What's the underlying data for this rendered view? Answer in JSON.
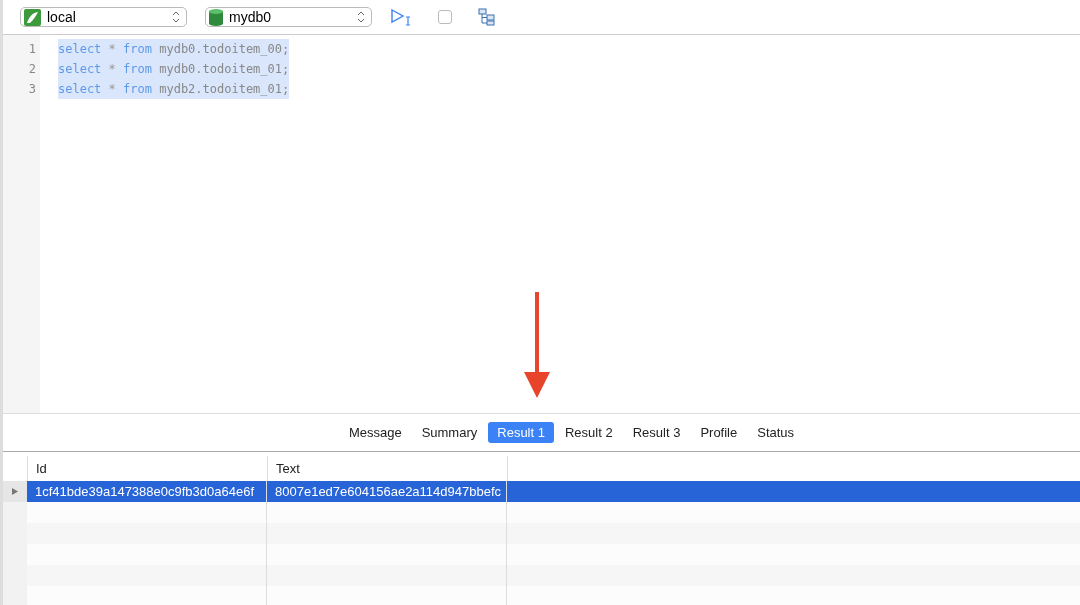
{
  "toolbar": {
    "connection": "local",
    "database": "mydb0",
    "stop_checked": false
  },
  "editor": {
    "lines": [
      {
        "number": "1",
        "selected": true,
        "tokens": [
          {
            "kind": "keyword",
            "text": "select"
          },
          {
            "kind": "op",
            "text": "*"
          },
          {
            "kind": "keyword",
            "text": "from"
          },
          {
            "kind": "ident",
            "text": "mydb0.todoitem_00;"
          }
        ]
      },
      {
        "number": "2",
        "selected": true,
        "tokens": [
          {
            "kind": "keyword",
            "text": "select"
          },
          {
            "kind": "op",
            "text": "*"
          },
          {
            "kind": "keyword",
            "text": "from"
          },
          {
            "kind": "ident",
            "text": "mydb0.todoitem_01;"
          }
        ]
      },
      {
        "number": "3",
        "selected": true,
        "tokens": [
          {
            "kind": "keyword",
            "text": "select"
          },
          {
            "kind": "op",
            "text": "*"
          },
          {
            "kind": "keyword",
            "text": "from"
          },
          {
            "kind": "ident",
            "text": "mydb2.todoitem_01;"
          }
        ]
      }
    ]
  },
  "result_tabs": [
    {
      "label": "Message",
      "selected": false
    },
    {
      "label": "Summary",
      "selected": false
    },
    {
      "label": "Result 1",
      "selected": true
    },
    {
      "label": "Result 2",
      "selected": false
    },
    {
      "label": "Result 3",
      "selected": false
    },
    {
      "label": "Profile",
      "selected": false
    },
    {
      "label": "Status",
      "selected": false
    }
  ],
  "table": {
    "columns": [
      "Id",
      "Text"
    ],
    "rows": [
      {
        "selected": true,
        "cells": [
          "1cf41bde39a147388e0c9fb3d0a64e6f",
          "8007e1ed7e604156ae2a114d947bbefc"
        ]
      }
    ]
  }
}
